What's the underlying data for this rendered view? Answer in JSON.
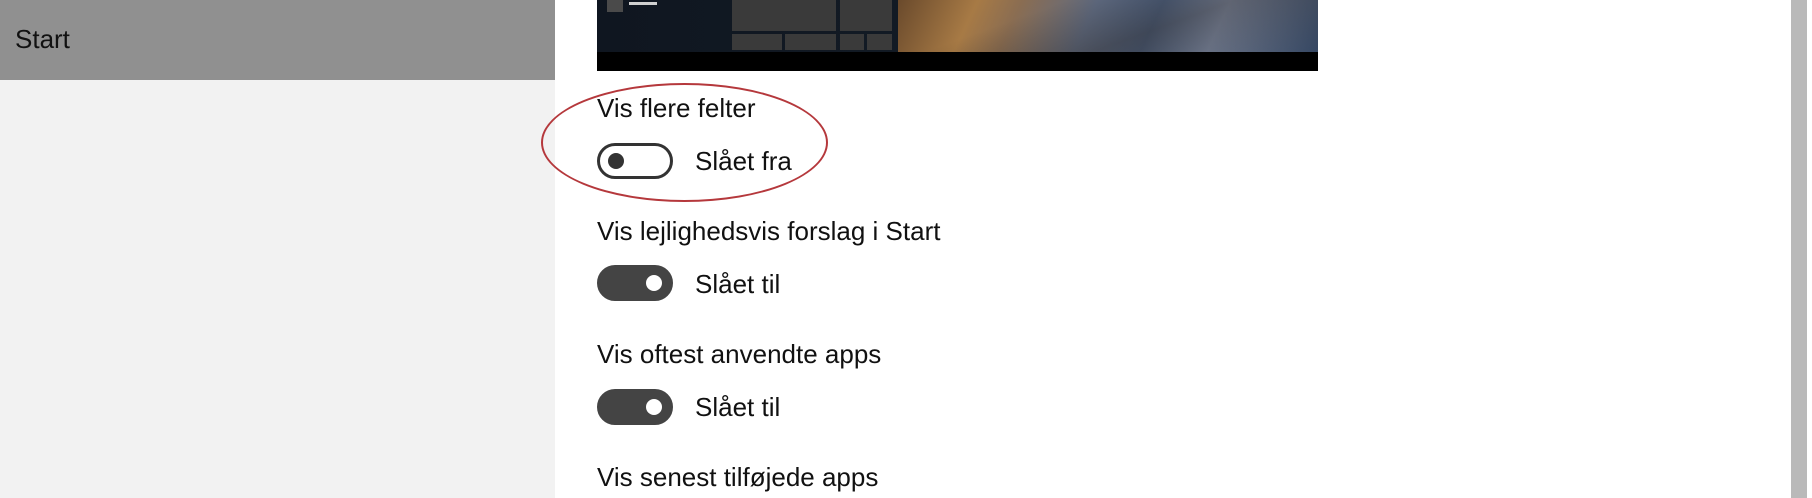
{
  "sidebar": {
    "selected_item": {
      "label": "Start"
    }
  },
  "settings": [
    {
      "label": "Vis flere felter",
      "state": "off",
      "state_label": "Slået fra"
    },
    {
      "label": "Vis lejlighedsvis forslag i Start",
      "state": "on",
      "state_label": "Slået til"
    },
    {
      "label": "Vis oftest anvendte apps",
      "state": "on",
      "state_label": "Slået til"
    },
    {
      "label": "Vis senest tilføjede apps"
    }
  ],
  "colors": {
    "sidebar_bg": "#f2f2f2",
    "selected_bg": "#909090",
    "toggle_on": "#444444",
    "annotation": "#b5383c"
  }
}
